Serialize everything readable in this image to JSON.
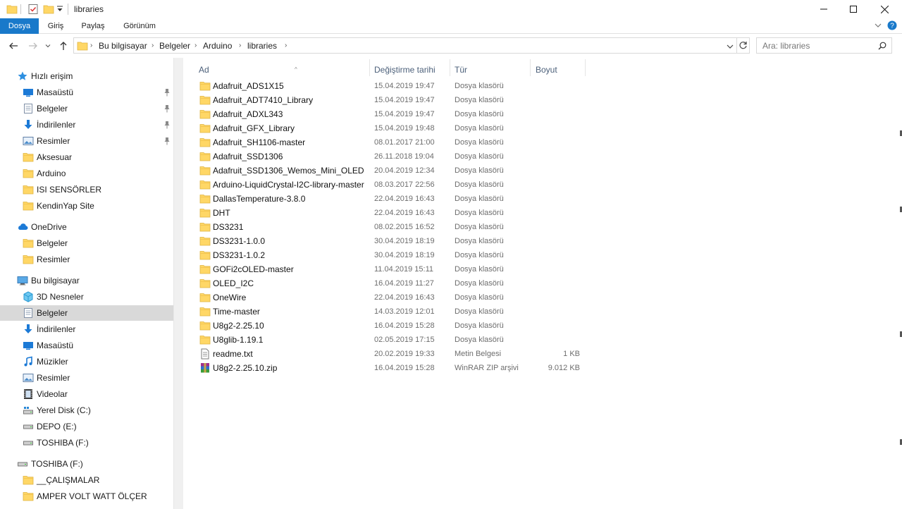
{
  "window": {
    "title": "libraries"
  },
  "ribbon": {
    "tabs": [
      "Dosya",
      "Giriş",
      "Paylaş",
      "Görünüm"
    ]
  },
  "address": {
    "crumbs": [
      "Bu bilgisayar",
      "Belgeler",
      "Arduino",
      "libraries"
    ],
    "search_placeholder": "Ara: libraries"
  },
  "columns": {
    "name": "Ad",
    "date": "Değiştirme tarihi",
    "type": "Tür",
    "size": "Boyut"
  },
  "nav": {
    "quick_access": "Hızlı erişim",
    "quick_items": [
      {
        "label": "Masaüstü",
        "icon": "desktop-icon",
        "pinned": true
      },
      {
        "label": "Belgeler",
        "icon": "documents-icon",
        "pinned": true
      },
      {
        "label": "İndirilenler",
        "icon": "download-icon",
        "pinned": true
      },
      {
        "label": "Resimler",
        "icon": "pictures-icon",
        "pinned": true
      },
      {
        "label": "Aksesuar",
        "icon": "folder-icon",
        "pinned": false
      },
      {
        "label": "Arduino",
        "icon": "folder-icon",
        "pinned": false
      },
      {
        "label": "ISI SENSÖRLER",
        "icon": "folder-icon",
        "pinned": false
      },
      {
        "label": "KendinYap Site",
        "icon": "folder-icon",
        "pinned": false
      }
    ],
    "onedrive": "OneDrive",
    "onedrive_items": [
      {
        "label": "Belgeler",
        "icon": "folder-icon"
      },
      {
        "label": "Resimler",
        "icon": "folder-icon"
      }
    ],
    "this_pc": "Bu bilgisayar",
    "pc_items": [
      {
        "label": "3D Nesneler",
        "icon": "3d-objects-icon"
      },
      {
        "label": "Belgeler",
        "icon": "documents-icon",
        "selected": true
      },
      {
        "label": "İndirilenler",
        "icon": "download-icon"
      },
      {
        "label": "Masaüstü",
        "icon": "desktop-icon"
      },
      {
        "label": "Müzikler",
        "icon": "music-icon"
      },
      {
        "label": "Resimler",
        "icon": "pictures-icon"
      },
      {
        "label": "Videolar",
        "icon": "video-icon"
      },
      {
        "label": "Yerel Disk (C:)",
        "icon": "local-disk-icon"
      },
      {
        "label": "DEPO (E:)",
        "icon": "drive-icon"
      },
      {
        "label": "TOSHIBA (F:)",
        "icon": "drive-icon"
      }
    ],
    "toshiba": "TOSHIBA (F:)",
    "toshiba_items": [
      {
        "label": "__ÇALIŞMALAR",
        "icon": "folder-icon"
      },
      {
        "label": "AMPER VOLT WATT ÖLÇER",
        "icon": "folder-icon"
      }
    ]
  },
  "files": [
    {
      "name": "Adafruit_ADS1X15",
      "date": "15.04.2019 19:47",
      "type": "Dosya klasörü",
      "size": "",
      "icon": "folder-icon"
    },
    {
      "name": "Adafruit_ADT7410_Library",
      "date": "15.04.2019 19:47",
      "type": "Dosya klasörü",
      "size": "",
      "icon": "folder-icon"
    },
    {
      "name": "Adafruit_ADXL343",
      "date": "15.04.2019 19:47",
      "type": "Dosya klasörü",
      "size": "",
      "icon": "folder-icon"
    },
    {
      "name": "Adafruit_GFX_Library",
      "date": "15.04.2019 19:48",
      "type": "Dosya klasörü",
      "size": "",
      "icon": "folder-icon"
    },
    {
      "name": "Adafruit_SH1106-master",
      "date": "08.01.2017 21:00",
      "type": "Dosya klasörü",
      "size": "",
      "icon": "folder-icon"
    },
    {
      "name": "Adafruit_SSD1306",
      "date": "26.11.2018 19:04",
      "type": "Dosya klasörü",
      "size": "",
      "icon": "folder-icon"
    },
    {
      "name": "Adafruit_SSD1306_Wemos_Mini_OLED",
      "date": "20.04.2019 12:34",
      "type": "Dosya klasörü",
      "size": "",
      "icon": "folder-icon"
    },
    {
      "name": "Arduino-LiquidCrystal-I2C-library-master",
      "date": "08.03.2017 22:56",
      "type": "Dosya klasörü",
      "size": "",
      "icon": "folder-icon"
    },
    {
      "name": "DallasTemperature-3.8.0",
      "date": "22.04.2019 16:43",
      "type": "Dosya klasörü",
      "size": "",
      "icon": "folder-icon"
    },
    {
      "name": "DHT",
      "date": "22.04.2019 16:43",
      "type": "Dosya klasörü",
      "size": "",
      "icon": "folder-icon"
    },
    {
      "name": "DS3231",
      "date": "08.02.2015 16:52",
      "type": "Dosya klasörü",
      "size": "",
      "icon": "folder-icon"
    },
    {
      "name": "DS3231-1.0.0",
      "date": "30.04.2019 18:19",
      "type": "Dosya klasörü",
      "size": "",
      "icon": "folder-icon"
    },
    {
      "name": "DS3231-1.0.2",
      "date": "30.04.2019 18:19",
      "type": "Dosya klasörü",
      "size": "",
      "icon": "folder-icon"
    },
    {
      "name": "GOFi2cOLED-master",
      "date": "11.04.2019 15:11",
      "type": "Dosya klasörü",
      "size": "",
      "icon": "folder-icon"
    },
    {
      "name": "OLED_I2C",
      "date": "16.04.2019 11:27",
      "type": "Dosya klasörü",
      "size": "",
      "icon": "folder-icon"
    },
    {
      "name": "OneWire",
      "date": "22.04.2019 16:43",
      "type": "Dosya klasörü",
      "size": "",
      "icon": "folder-icon"
    },
    {
      "name": "Time-master",
      "date": "14.03.2019 12:01",
      "type": "Dosya klasörü",
      "size": "",
      "icon": "folder-icon"
    },
    {
      "name": "U8g2-2.25.10",
      "date": "16.04.2019 15:28",
      "type": "Dosya klasörü",
      "size": "",
      "icon": "folder-icon"
    },
    {
      "name": "U8glib-1.19.1",
      "date": "02.05.2019 17:15",
      "type": "Dosya klasörü",
      "size": "",
      "icon": "folder-icon"
    },
    {
      "name": "readme.txt",
      "date": "20.02.2019 19:33",
      "type": "Metin Belgesi",
      "size": "1 KB",
      "icon": "text-file-icon"
    },
    {
      "name": "U8g2-2.25.10.zip",
      "date": "16.04.2019 15:28",
      "type": "WinRAR ZIP arşivi",
      "size": "9.012 KB",
      "icon": "winrar-archive-icon"
    }
  ],
  "colors": {
    "accent": "#1979ca",
    "folder": "#ffd766",
    "selected_bg": "#d9d9d9"
  }
}
